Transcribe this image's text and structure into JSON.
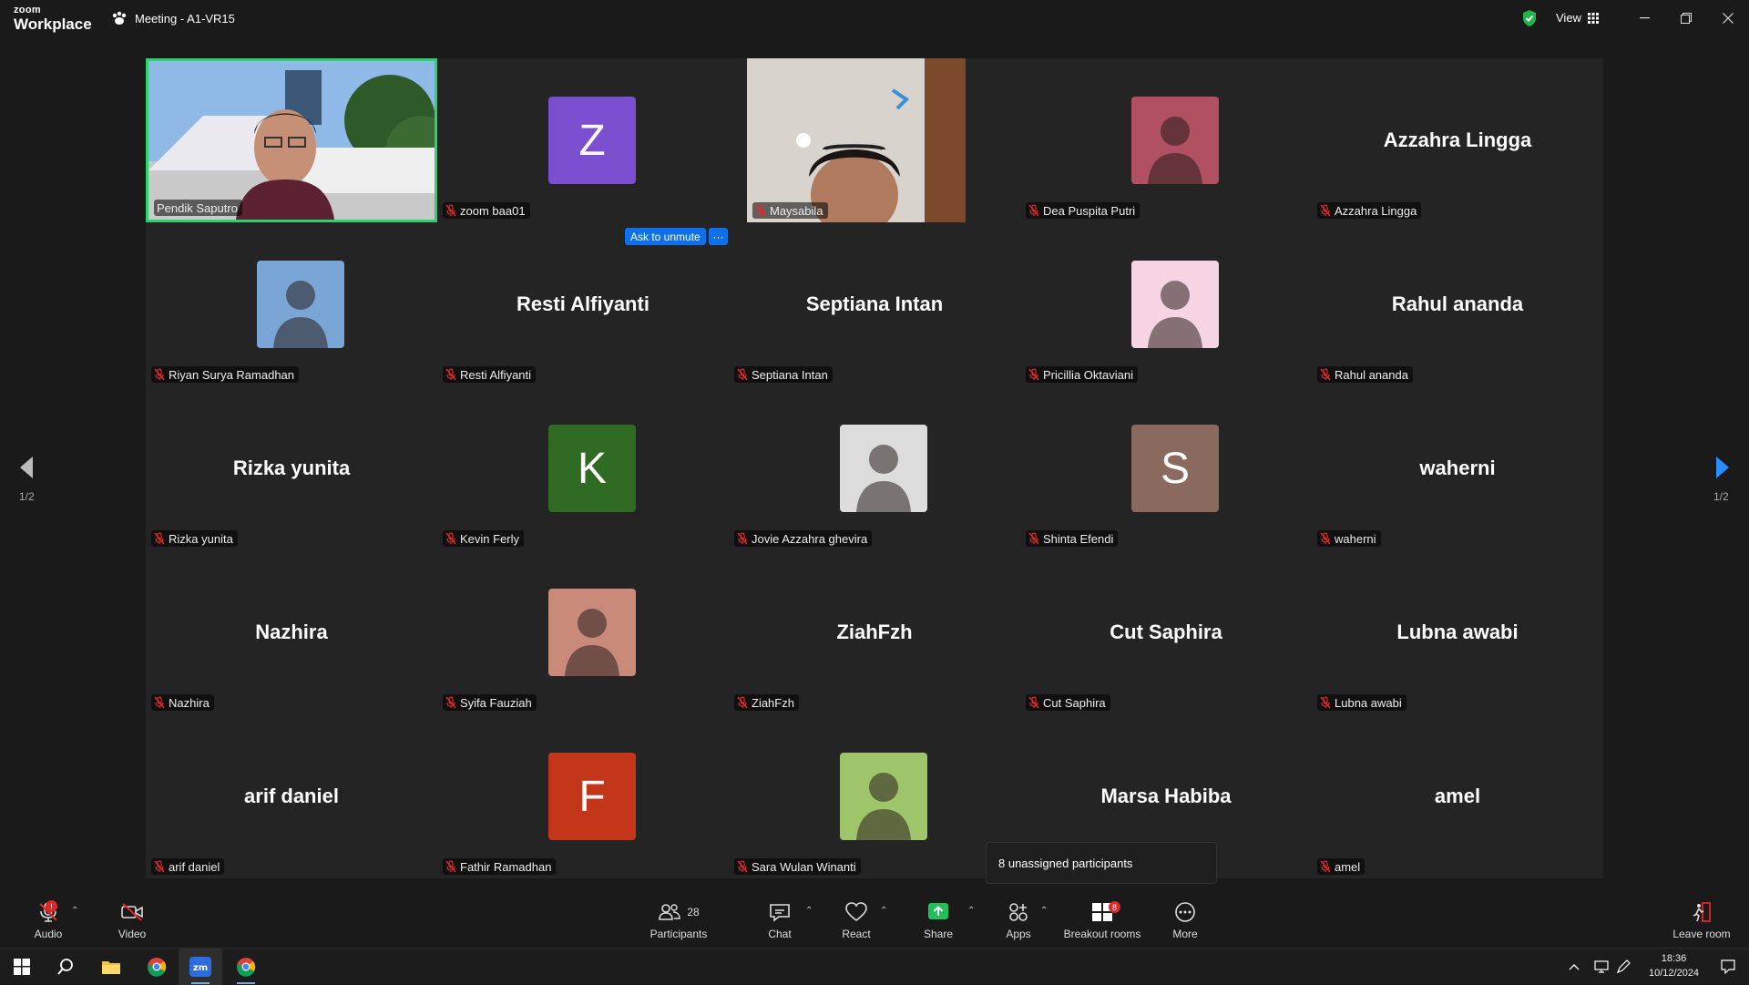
{
  "app": {
    "brand_line1": "zoom",
    "brand_line2": "Workplace",
    "meeting_title": "Meeting - A1-VR15",
    "view_label": "View"
  },
  "colors": {
    "active_speaker": "#2cd36b",
    "accent_blue": "#0e71eb",
    "share_green": "#22c05b",
    "mute_red": "#e02828"
  },
  "participants": [
    {
      "name": "Pendik Saputro",
      "display": "video",
      "active": true
    },
    {
      "name": "zoom baa01",
      "display": "letter",
      "letter": "Z",
      "color": "#7b4fcf"
    },
    {
      "name": "Maysabila",
      "display": "video"
    },
    {
      "name": "Dea Puspita Putri",
      "display": "photo",
      "color": "#b05060"
    },
    {
      "name": "Azzahra Lingga",
      "display": "name"
    },
    {
      "name": "Riyan Surya Ramadhan",
      "display": "photo",
      "color": "#7aa6d6"
    },
    {
      "name": "Resti Alfiyanti",
      "display": "name"
    },
    {
      "name": "Septiana Intan",
      "display": "name"
    },
    {
      "name": "Pricillia Oktaviani",
      "display": "photo",
      "color": "#f6d4e3"
    },
    {
      "name": "Rahul ananda",
      "display": "name"
    },
    {
      "name": "Rizka yunita",
      "display": "name"
    },
    {
      "name": "Kevin Ferly",
      "display": "letter",
      "letter": "K",
      "color": "#2f6b22"
    },
    {
      "name": "Jovie Azzahra ghevira",
      "display": "photo",
      "color": "#dcdcdc"
    },
    {
      "name": "Shinta Efendi",
      "display": "letter",
      "letter": "S",
      "color": "#8a6a5e"
    },
    {
      "name": "waherni",
      "display": "name"
    },
    {
      "name": "Nazhira",
      "display": "name"
    },
    {
      "name": "Syifa Fauziah",
      "display": "photo",
      "color": "#c98a7a"
    },
    {
      "name": "ZiahFzh",
      "display": "name"
    },
    {
      "name": "Cut Saphira",
      "display": "name"
    },
    {
      "name": "Lubna awabi",
      "display": "name"
    },
    {
      "name": "arif daniel",
      "display": "name"
    },
    {
      "name": "Fathir Ramadhan",
      "display": "letter",
      "letter": "F",
      "color": "#c4361a"
    },
    {
      "name": "Sara Wulan Winanti",
      "display": "photo",
      "color": "#9fc56a"
    },
    {
      "name": "Marsa Habiba",
      "display": "name",
      "hide_label": true
    },
    {
      "name": "amel",
      "display": "name"
    }
  ],
  "ask_to_unmute": {
    "label": "Ask to unmute",
    "more": "···"
  },
  "unassigned_tooltip": "8 unassigned participants",
  "paging": {
    "left": "1/2",
    "right": "1/2"
  },
  "toolbar": {
    "audio": "Audio",
    "video": "Video",
    "participants": "Participants",
    "participants_count": "28",
    "chat": "Chat",
    "react": "React",
    "share": "Share",
    "apps": "Apps",
    "breakout": "Breakout rooms",
    "breakout_badge": "8",
    "more": "More",
    "leave": "Leave room"
  },
  "taskbar": {
    "time": "18:36",
    "date": "10/12/2024"
  }
}
